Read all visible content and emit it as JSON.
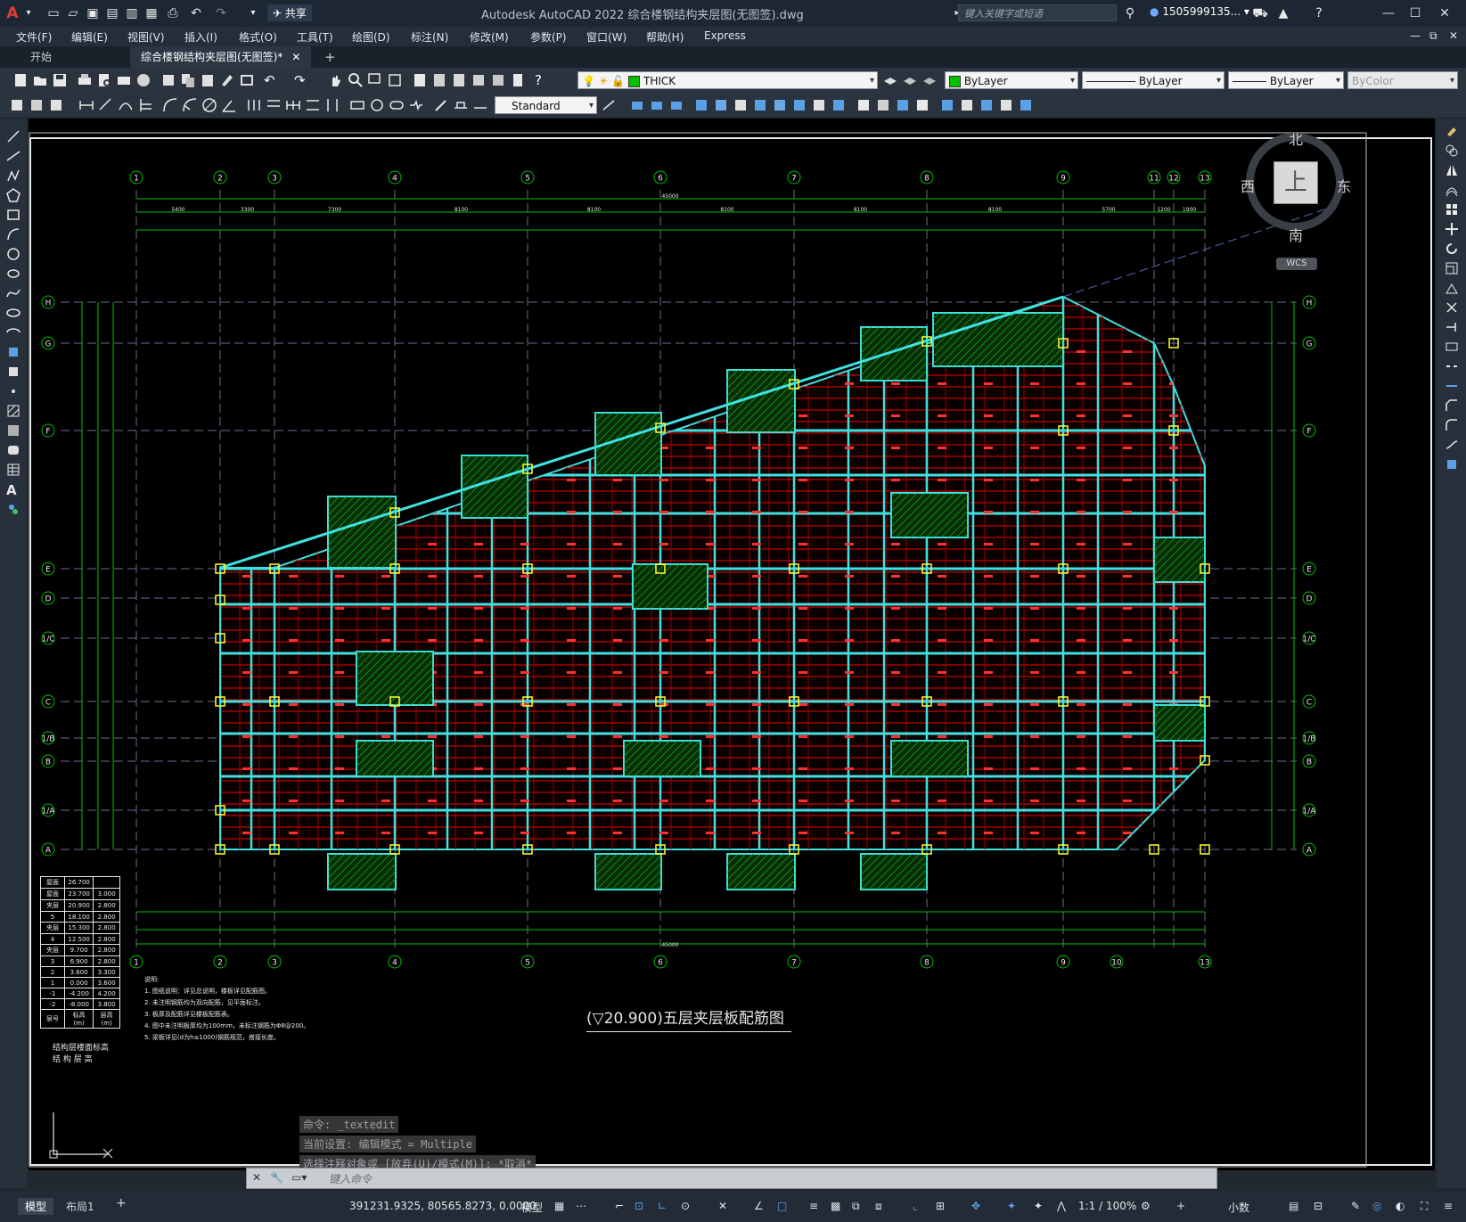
{
  "app": {
    "logo": "A",
    "title": "Autodesk AutoCAD 2022    综合楼钢结构夹层图(无图签).dwg",
    "share_label": "共享"
  },
  "search": {
    "placeholder": "键入关键字或短语"
  },
  "user": {
    "name": "1505999135..."
  },
  "menu": [
    "文件(F)",
    "编辑(E)",
    "视图(V)",
    "插入(I)",
    "格式(O)",
    "工具(T)",
    "绘图(D)",
    "标注(N)",
    "修改(M)",
    "参数(P)",
    "窗口(W)",
    "帮助(H)",
    "Express"
  ],
  "file_tabs": [
    {
      "label": "开始"
    },
    {
      "label": "综合楼钢结构夹层图(无图签)*"
    }
  ],
  "layer": {
    "name": "THICK",
    "color": "#00c000"
  },
  "properties": {
    "color": "ByLayer",
    "linetype": "ByLayer",
    "lineweight": "ByLayer",
    "plotstyle": "ByColor"
  },
  "text_style": "Standard",
  "viewcube": {
    "north": "北",
    "south": "南",
    "east": "东",
    "west": "西",
    "face": "上",
    "wcs": "WCS"
  },
  "drawing": {
    "title": "(▽20.900)五层夹层板配筋图",
    "grid_top": [
      "1",
      "2",
      "3",
      "4",
      "5",
      "6",
      "7",
      "8",
      "9",
      "11",
      "12",
      "13"
    ],
    "grid_bottom": [
      "1",
      "2",
      "3",
      "4",
      "5",
      "6",
      "7",
      "8",
      "9",
      "10",
      "13"
    ],
    "grid_rows": [
      "H",
      "G",
      "F",
      "E",
      "D",
      "1/C",
      "C",
      "1/B",
      "B",
      "1/A",
      "A"
    ],
    "dim_top": [
      "5400",
      "3300",
      "7300",
      "8100",
      "8100",
      "8100",
      "8100",
      "8100",
      "5700",
      "1200",
      "1900"
    ],
    "dim_top_total": "45000",
    "dim_bottom_total": "45000",
    "level_table": {
      "rows": [
        [
          "屋面",
          "26.700",
          ""
        ],
        [
          "屋面",
          "23.700",
          "3.000"
        ],
        [
          "夹层",
          "20.900",
          "2.800"
        ],
        [
          "5",
          "18.100",
          "2.800"
        ],
        [
          "夹层",
          "15.300",
          "2.800"
        ],
        [
          "4",
          "12.500",
          "2.800"
        ],
        [
          "夹层",
          "9.700",
          "2.800"
        ],
        [
          "3",
          "6.900",
          "2.800"
        ],
        [
          "2",
          "3.600",
          "3.300"
        ],
        [
          "1",
          "0.000",
          "3.600"
        ],
        [
          "-1",
          "-4.200",
          "4.200"
        ],
        [
          "-2",
          "-8.000",
          "3.800"
        ],
        [
          "层号",
          "标高(m)",
          "层高(m)"
        ]
      ],
      "caption1": "结构层楼面标高",
      "caption2": "结 构 层 高"
    },
    "notes": [
      "说明:",
      "1. 图纸说明：详见总说明，楼板详见配筋图。",
      "2. 未注明钢筋均为双向配筋，见平面标注。",
      "3. 板厚及配筋详见楼板配筋表。",
      "4. 图中未注明板厚均为100mm，未标注钢筋为Φ8@200。",
      "5. 梁板详见(d为h≤1000)钢筋规范，搭接长度。"
    ]
  },
  "command": {
    "history": [
      "命令: _textedit",
      "当前设置: 编辑模式 = Multiple",
      "选择注释对象或 [放弃(U)/模式(M)]: *取消*"
    ],
    "placeholder": "键入命令"
  },
  "status": {
    "tabs": [
      {
        "label": "模型"
      },
      {
        "label": "布局1"
      }
    ],
    "coords": "391231.9325, 80565.8273, 0.0000",
    "model_label": "模型",
    "scale": "1:1 / 100%",
    "units": "小数"
  }
}
